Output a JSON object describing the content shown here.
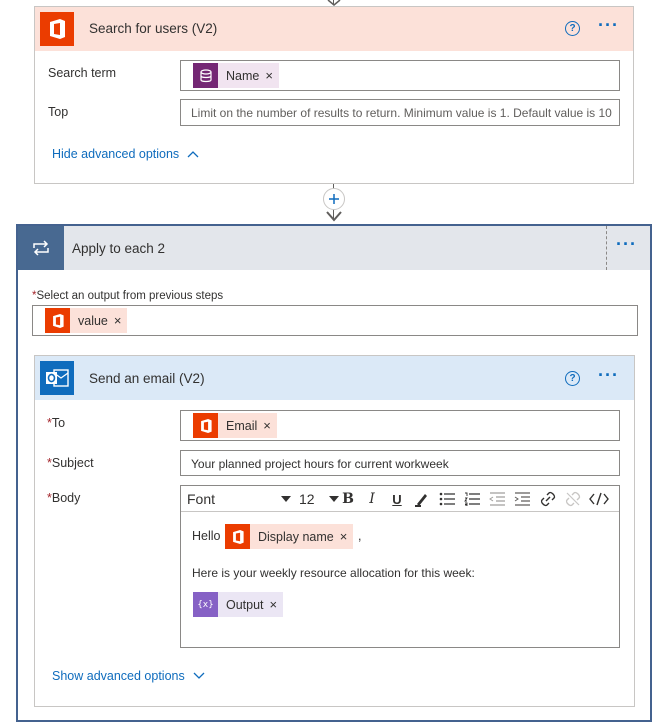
{
  "search_card": {
    "title": "Search for users (V2)",
    "search_term_label": "Search term",
    "search_term_token": "Name",
    "top_label": "Top",
    "top_placeholder": "Limit on the number of results to return. Minimum value is 1. Default value is 10",
    "hide_advanced": "Hide advanced options"
  },
  "apply_card": {
    "title": "Apply to each 2",
    "select_label": "Select an output from previous steps",
    "select_token": "value"
  },
  "email_card": {
    "title": "Send an email (V2)",
    "to_label": "To",
    "to_token": "Email",
    "subject_label": "Subject",
    "subject_value": "Your planned project hours for current workweek",
    "body_label": "Body",
    "toolbar": {
      "font": "Font",
      "size": "12"
    },
    "body_hello": "Hello",
    "body_token_name": "Display name",
    "body_comma": ",",
    "body_line2": "Here is your weekly resource allocation for this week:",
    "body_token_output": "Output",
    "show_advanced": "Show advanced options"
  },
  "colors": {
    "office_red": "#eb3c00",
    "search_header": "#fce1d9",
    "email_header": "#dbe9f7",
    "apply_header": "#e3e6eb",
    "link_blue": "#0f6cbd",
    "variable_purple": "#742774",
    "expression_purple": "#8661c5"
  }
}
